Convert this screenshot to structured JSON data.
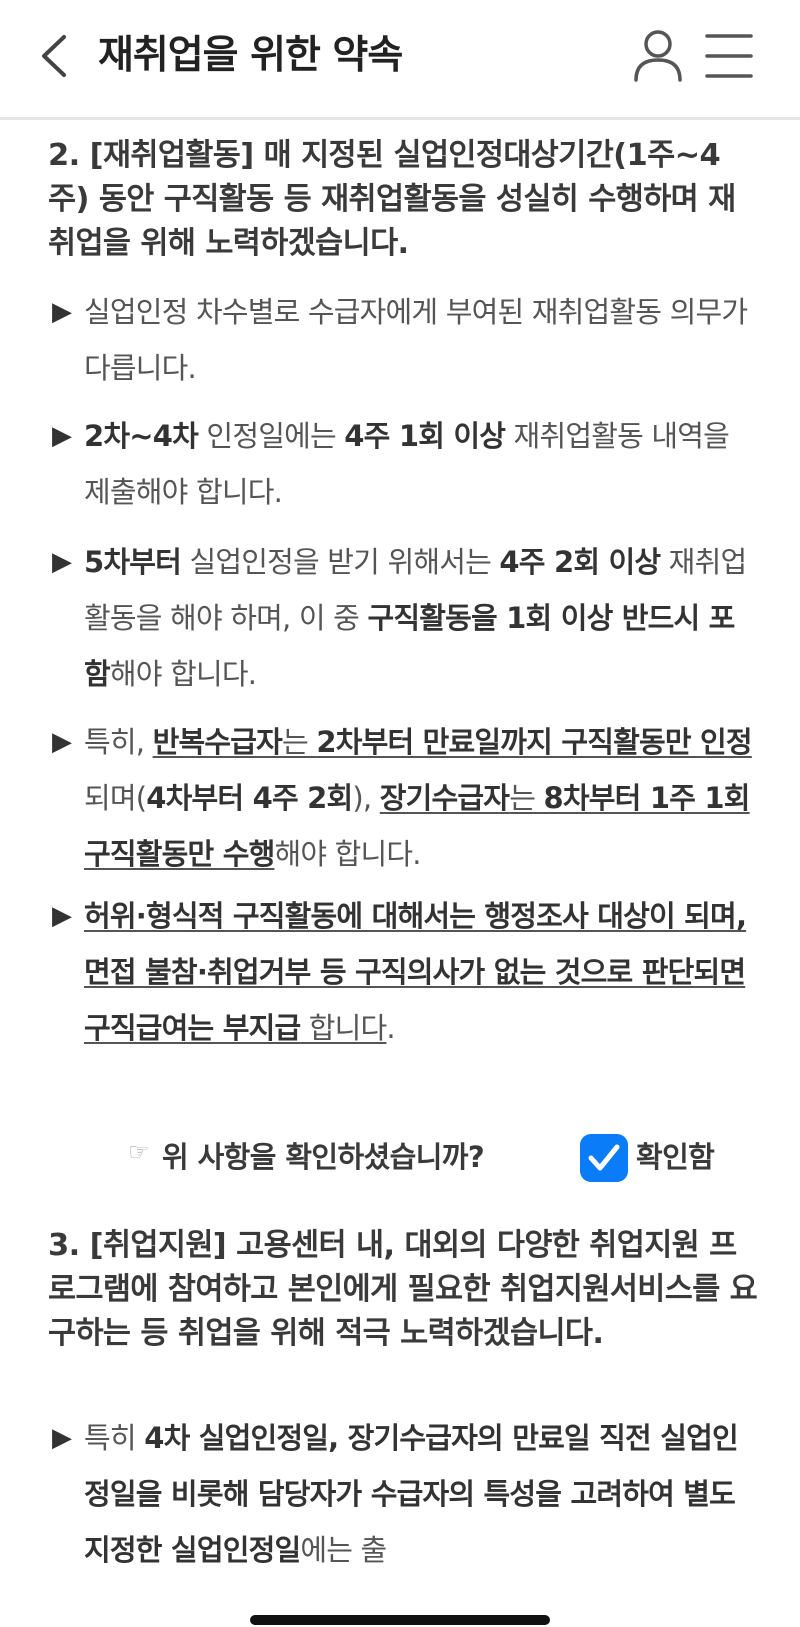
{
  "header": {
    "title": "재취업을 위한 약속",
    "back_icon": "chevron-left-icon",
    "user_icon": "user-icon",
    "menu_icon": "hamburger-menu-icon"
  },
  "section2": {
    "title": "2. [재취업활동] 매 지정된 실업인정대상기간(1주~4주) 동안 구직활동 등 재취업활동을 성실히 수행하며 재취업을 위해 노력하겠습니다.",
    "bullets": [
      {
        "s1": "실업인정 차수별로 수급자에게 부여된 재취업활동 의무가 다릅니다."
      },
      {
        "b1": "2차~4차",
        "s2": " 인정일에는 ",
        "b3": "4주 1회 이상",
        "s4": " 재취업활동 내역을 제출해야 합니다."
      },
      {
        "b1": "5차부터",
        "s2": " 실업인정을 받기 위해서는 ",
        "b3": "4주 2회 이상",
        "s4": " 재취업활동을 해야 하며, 이 중 ",
        "b5": "구직활동을 1회 이상 반드시 포함",
        "s6": "해야 합니다."
      },
      {
        "s1": "특히, ",
        "b2": "반복수급자",
        "u3": "는 ",
        "b4": "2차부터 만료일까지 구직활동만 인정",
        "s5": "되며(",
        "b6": "4차부터 4주 2회",
        "s7": "), ",
        "b8": "장기수급자",
        "u9": "는 ",
        "b10": "8차부터 1주 1회 구직활동만 수행",
        "s11": "해야 합니다."
      },
      {
        "b1": "허위·형식적 구직활동에 대해서는 행정조사 대상이 되며, 면접 불참·취업거부 등 구직의사가 없는 것으로 판단되면 구직급여는 부지급",
        "u2": " 합니다",
        "s3": "."
      }
    ]
  },
  "confirm": {
    "hand_symbol": "☞",
    "question": "위 사항을 확인하셨습니까?",
    "checked": true,
    "label": "확인함",
    "checkbox_color": "#0a7cf8"
  },
  "section3": {
    "title": "3. [취업지원] 고용센터 내, 대외의 다양한 취업지원 프로그램에 참여하고 본인에게 필요한 취업지원서비스를 요구하는 등 취업을 위해 적극 노력하겠습니다.",
    "bullets": [
      {
        "s1": "특히 ",
        "b2": "4차 실업인정일, 장기수급자의 만료일 직전 실업인정일을 비롯해 담당자가 수급자의 특성을 고려하여 별도 지정한 실업인정일",
        "s3": "에는 출"
      }
    ]
  }
}
